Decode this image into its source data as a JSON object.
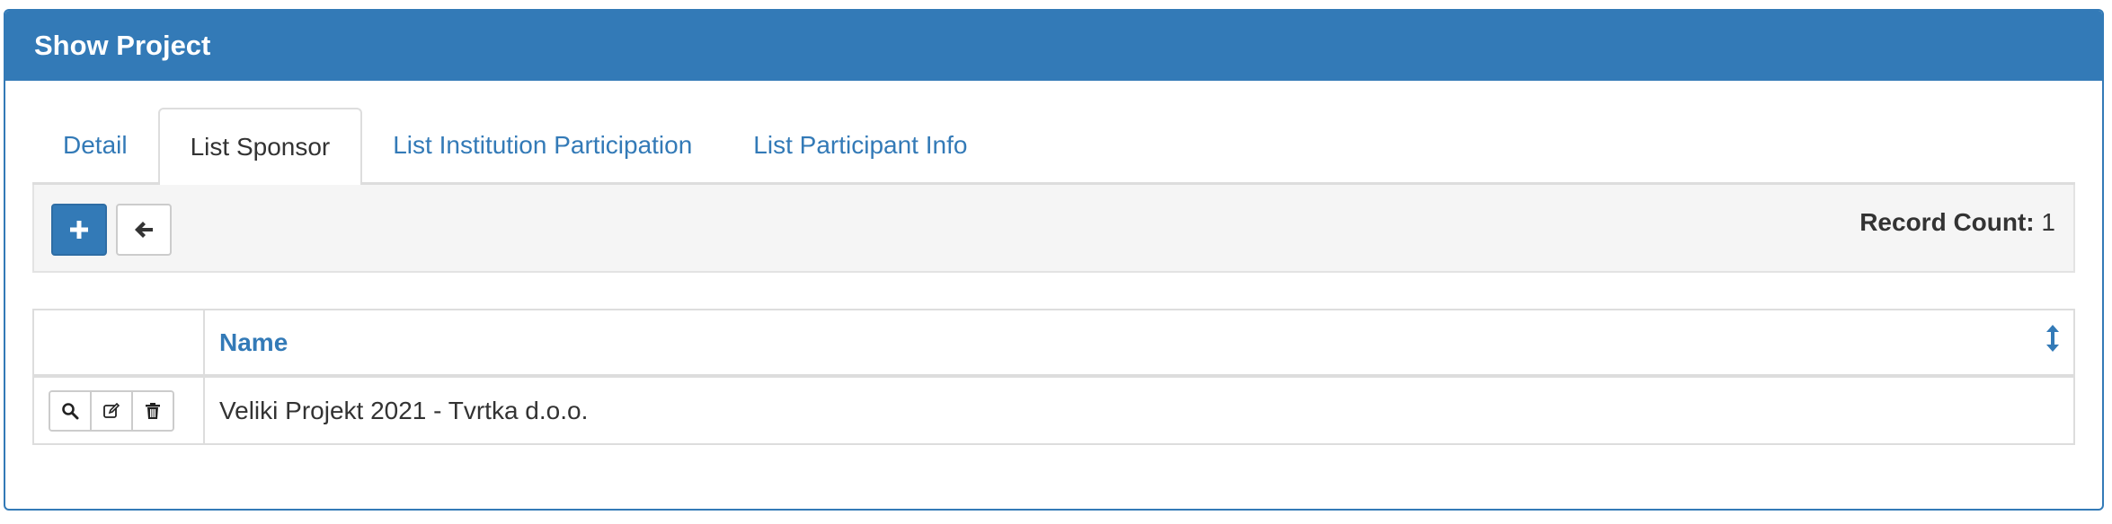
{
  "panel": {
    "title": "Show Project"
  },
  "tabs": [
    {
      "label": "Detail",
      "active": false
    },
    {
      "label": "List Sponsor",
      "active": true
    },
    {
      "label": "List Institution Participation",
      "active": false
    },
    {
      "label": "List Participant Info",
      "active": false
    }
  ],
  "toolbar": {
    "add_icon": "plus-icon",
    "back_icon": "arrow-left-icon",
    "record_count_label": "Record Count:",
    "record_count_value": "1"
  },
  "table": {
    "columns": [
      "",
      "Name"
    ],
    "sort_icon": "sort-vertical-icon",
    "rows": [
      {
        "actions": [
          "search-icon",
          "edit-icon",
          "trash-icon"
        ],
        "name": "Veliki Projekt 2021 - Tvrtka d.o.o."
      }
    ]
  },
  "colors": {
    "primary": "#337ab7",
    "border": "#dddddd",
    "toolbar_bg": "#f5f5f5"
  }
}
